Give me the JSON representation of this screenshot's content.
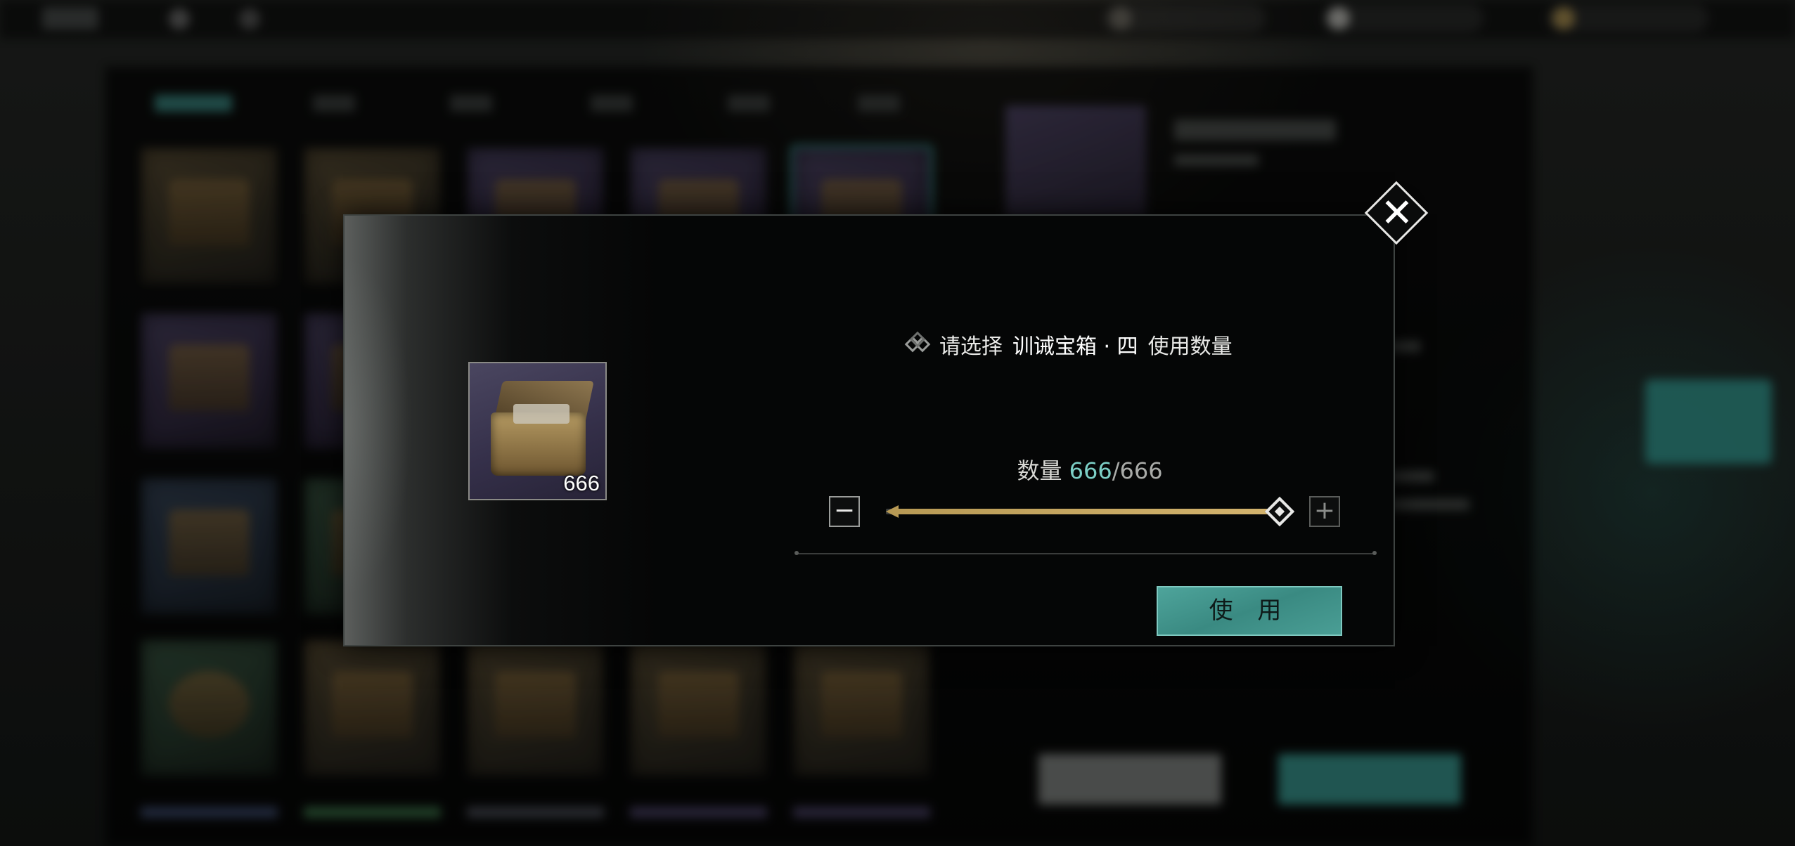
{
  "modal": {
    "prompt_prefix": "请选择",
    "item_name": "训诫宝箱 · 四",
    "prompt_suffix": "使用数量",
    "quantity_label": "数量",
    "quantity_current": "666",
    "quantity_separator": "/",
    "quantity_max": "666",
    "slider_fraction": 1.0,
    "item_count": "666",
    "use_button_label": "使 用",
    "minus_label": "−",
    "plus_label": "+",
    "close_label": "✕"
  },
  "icons": {
    "close": "close-icon",
    "minus": "minus-icon",
    "plus": "plus-icon",
    "prompt_deco": "diamond-ornament-icon",
    "item": "treasure-chest-icon"
  },
  "colors": {
    "accent_teal": "#4ea49b",
    "quantity_highlight": "#7ccfc6",
    "slider_fill": "#d4b46e"
  }
}
